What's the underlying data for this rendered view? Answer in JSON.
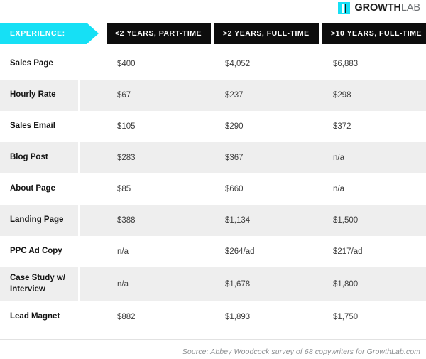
{
  "logo": {
    "mark_icon": "growthlab-bars-icon",
    "text_bold": "GROWTH",
    "text_light": "LAB",
    "accent_color": "#16e0f5"
  },
  "header": {
    "experience_label": "EXPERIENCE:",
    "columns": [
      "<2 YEARS, PART-TIME",
      ">2 YEARS, FULL-TIME",
      ">10 YEARS, FULL-TIME"
    ]
  },
  "chart_data": {
    "type": "table",
    "title": "",
    "row_header": "EXPERIENCE:",
    "categories": [
      "<2 YEARS, PART-TIME",
      ">2 YEARS, FULL-TIME",
      ">10 YEARS, FULL-TIME"
    ],
    "rows": [
      {
        "label": "Sales Page",
        "values": [
          "$400",
          "$4,052",
          "$6,883"
        ]
      },
      {
        "label": "Hourly Rate",
        "values": [
          "$67",
          "$237",
          "$298"
        ]
      },
      {
        "label": "Sales Email",
        "values": [
          "$105",
          "$290",
          "$372"
        ]
      },
      {
        "label": "Blog Post",
        "values": [
          "$283",
          "$367",
          "n/a"
        ]
      },
      {
        "label": "About Page",
        "values": [
          "$85",
          "$660",
          "n/a"
        ]
      },
      {
        "label": "Landing Page",
        "values": [
          "$388",
          "$1,134",
          "$1,500"
        ]
      },
      {
        "label": "PPC Ad Copy",
        "values": [
          "n/a",
          "$264/ad",
          "$217/ad"
        ]
      },
      {
        "label": "Case Study w/\nInterview",
        "values": [
          "n/a",
          "$1,678",
          "$1,800"
        ]
      },
      {
        "label": "Lead Magnet",
        "values": [
          "$882",
          "$1,893",
          "$1,750"
        ]
      }
    ]
  },
  "footer": {
    "source": "Source: Abbey Woodcock survey of 68 copywriters for GrowthLab.com"
  }
}
